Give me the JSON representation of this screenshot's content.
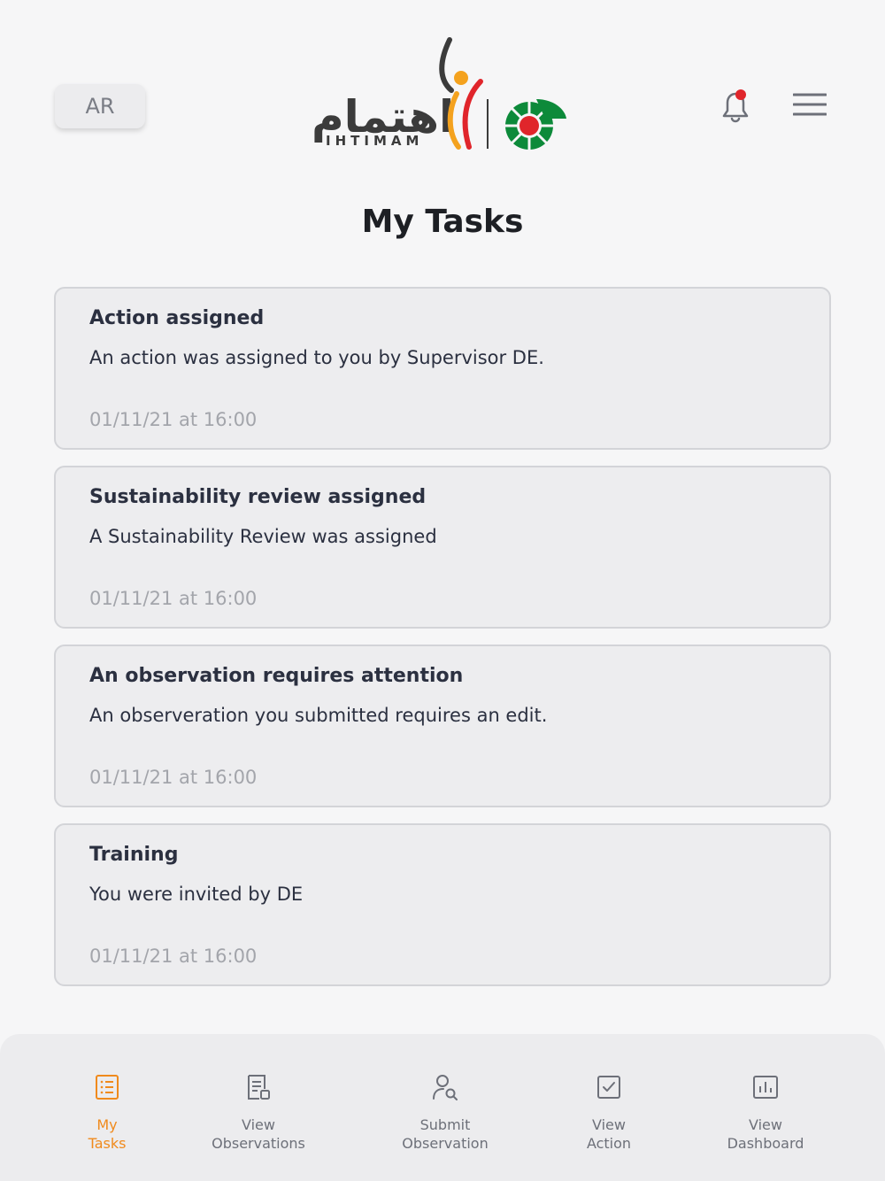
{
  "header": {
    "lang_button": "AR",
    "logo_arabic": "اهتمام",
    "logo_latin": "IHTIMAM"
  },
  "page_title": "My Tasks",
  "tasks": [
    {
      "title": "Action assigned",
      "description": "An action was assigned to you by Supervisor DE.",
      "time": "01/11/21 at 16:00"
    },
    {
      "title": "Sustainability review assigned",
      "description": "A Sustainability Review was assigned",
      "time": "01/11/21 at 16:00"
    },
    {
      "title": "An observation requires attention",
      "description": "An observeration you submitted requires an edit.",
      "time": "01/11/21 at 16:00"
    },
    {
      "title": "Training",
      "description": "You were invited by DE",
      "time": "01/11/21 at 16:00"
    }
  ],
  "bottom_nav": [
    {
      "label": "My\nTasks",
      "icon": "list-icon",
      "active": true
    },
    {
      "label": "View\nObservations",
      "icon": "document-icon",
      "active": false
    },
    {
      "label": "Submit\nObservation",
      "icon": "user-search-icon",
      "active": false
    },
    {
      "label": "View\nAction",
      "icon": "checkbox-icon",
      "active": false
    },
    {
      "label": "View\nDashboard",
      "icon": "bar-chart-icon",
      "active": false
    }
  ],
  "colors": {
    "accent": "#f08a1c",
    "notification_dot": "#e0252b",
    "emblem_green": "#0d8a3a",
    "emblem_red": "#e0252b"
  }
}
